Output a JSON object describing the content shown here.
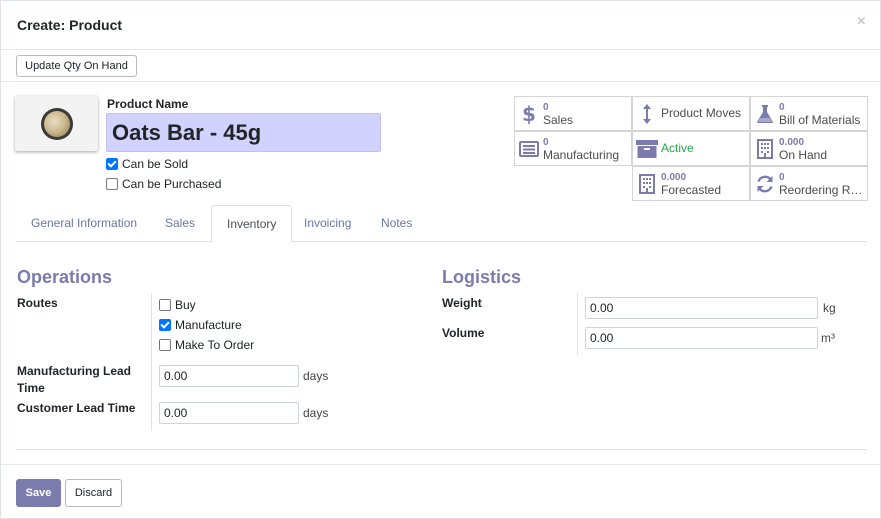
{
  "dialog": {
    "title": "Create: Product",
    "close_symbol": "×"
  },
  "statusbar": {
    "update_qty_label": "Update Qty On Hand"
  },
  "product": {
    "image_icon": "oats-bar-photo",
    "name_label": "Product Name",
    "name_value": "Oats Bar - 45g",
    "can_be_sold_label": "Can be Sold",
    "can_be_sold": true,
    "can_be_purchased_label": "Can be Purchased",
    "can_be_purchased": false
  },
  "smart_buttons": [
    {
      "icon": "dollar-icon",
      "value": "0",
      "label": "Sales"
    },
    {
      "icon": "up-down-arrows-icon",
      "value": "",
      "label": "Product Moves"
    },
    {
      "icon": "flask-icon",
      "value": "0",
      "label": "Bill of Materials"
    },
    {
      "icon": "list-icon",
      "value": "0",
      "label": "Manufacturing"
    },
    {
      "icon": "archive-icon",
      "value": "",
      "label": "Active"
    },
    {
      "icon": "building-icon",
      "value": "0.000",
      "label": "On Hand"
    },
    {
      "icon": "building-icon",
      "value": "0.000",
      "label": "Forecasted"
    },
    {
      "icon": "refresh-icon",
      "value": "0",
      "label": "Reordering Rules"
    }
  ],
  "tabs": [
    {
      "label": "General Information",
      "active": false
    },
    {
      "label": "Sales",
      "active": false
    },
    {
      "label": "Inventory",
      "active": true
    },
    {
      "label": "Invoicing",
      "active": false
    },
    {
      "label": "Notes",
      "active": false
    }
  ],
  "operations": {
    "title": "Operations",
    "routes_label": "Routes",
    "routes": [
      {
        "label": "Buy",
        "checked": false
      },
      {
        "label": "Manufacture",
        "checked": true
      },
      {
        "label": "Make To Order",
        "checked": false
      }
    ],
    "mfg_lead_label": "Manufacturing Lead Time",
    "mfg_lead_value": "0.00",
    "mfg_lead_unit": "days",
    "customer_lead_label": "Customer Lead Time",
    "customer_lead_value": "0.00",
    "customer_lead_unit": "days"
  },
  "logistics": {
    "title": "Logistics",
    "weight_label": "Weight",
    "weight_value": "0.00",
    "weight_unit": "kg",
    "volume_label": "Volume",
    "volume_value": "0.00",
    "volume_unit": "m³"
  },
  "footer": {
    "save_label": "Save",
    "discard_label": "Discard"
  },
  "colors": {
    "primary": "#7c7bad",
    "name_field_bg": "#d2d2ff",
    "active_green": "#28a745"
  }
}
